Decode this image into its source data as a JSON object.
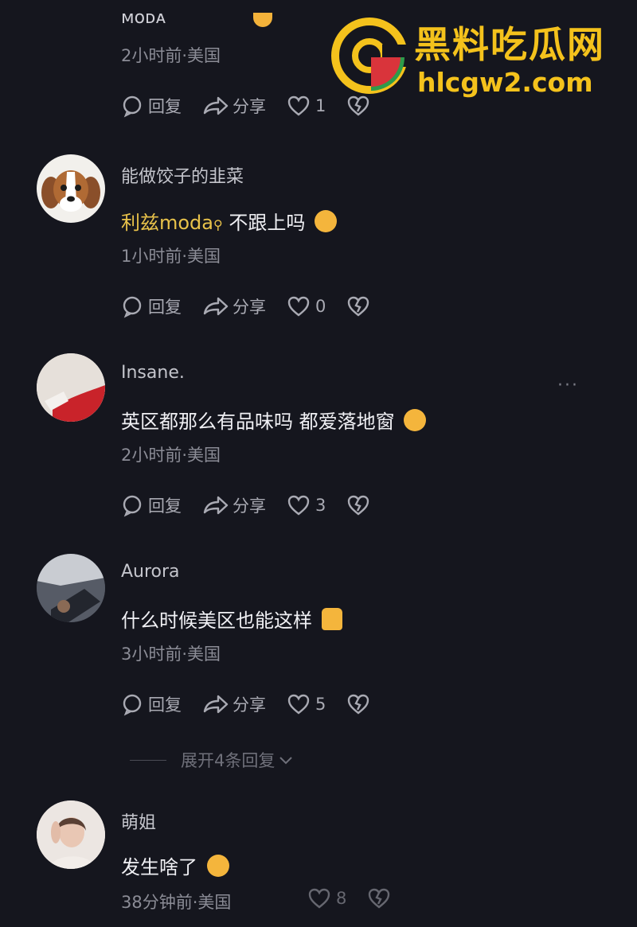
{
  "watermark": {
    "title": "黑料吃瓜网",
    "url": "hlcgw2.com"
  },
  "labels": {
    "reply": "回复",
    "share": "分享"
  },
  "top_comment": {
    "name": "ᴍᴏᴅᴀ",
    "meta": "2小时前·美国",
    "likes": "1"
  },
  "comments": [
    {
      "name": "能做饺子的韭菜",
      "mention": "利兹moda",
      "text": "不跟上吗",
      "meta": "1小时前·美国",
      "likes": "0",
      "avatar": "dog-avatar"
    },
    {
      "name": "Insane.",
      "text": "英区都那么有品味吗 都爱落地窗",
      "meta": "2小时前·美国",
      "likes": "3",
      "avatar": "red-sleeve-avatar"
    },
    {
      "name": "Aurora",
      "text": "什么时候美区也能这样",
      "meta": "3小时前·美国",
      "likes": "5",
      "avatar": "car-avatar"
    },
    {
      "name": "萌姐",
      "text": "发生啥了",
      "meta": "38分钟前·美国",
      "likes": "8",
      "avatar": "girl-avatar"
    }
  ],
  "expand_replies": "展开4条回复",
  "more_menu": "···"
}
